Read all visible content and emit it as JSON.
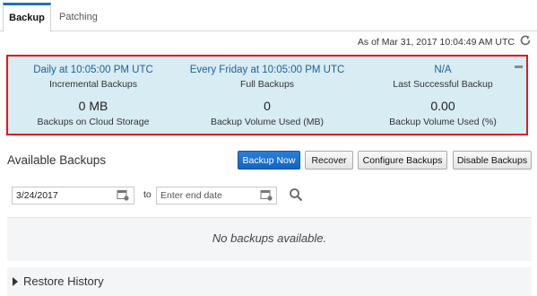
{
  "tabs": [
    {
      "label": "Backup",
      "active": true
    },
    {
      "label": "Patching",
      "active": false
    }
  ],
  "as_of": "As of Mar 31, 2017 10:04:49 AM UTC",
  "summary": {
    "incremental": {
      "value": "Daily at 10:05:00 PM UTC",
      "label": "Incremental Backups"
    },
    "full": {
      "value": "Every Friday at 10:05:00 PM UTC",
      "label": "Full Backups"
    },
    "last_success": {
      "value": "N/A",
      "label": "Last Successful Backup"
    },
    "cloud_storage": {
      "value": "0 MB",
      "label": "Backups on Cloud Storage"
    },
    "volume_mb": {
      "value": "0",
      "label": "Backup Volume Used (MB)"
    },
    "volume_pct": {
      "value": "0.00",
      "label": "Backup Volume Used (%)"
    }
  },
  "available": {
    "title": "Available Backups",
    "buttons": {
      "backup_now": "Backup Now",
      "recover": "Recover",
      "configure": "Configure Backups",
      "disable": "Disable Backups"
    },
    "start_date": "3/24/2017",
    "to_label": "to",
    "end_placeholder": "Enter end date",
    "empty_text": "No backups available."
  },
  "restore_history": {
    "label": "Restore History"
  },
  "colors": {
    "accent": "#1a73b8",
    "highlight_border": "#e8161a",
    "summary_bg": "#d7ecf3"
  }
}
